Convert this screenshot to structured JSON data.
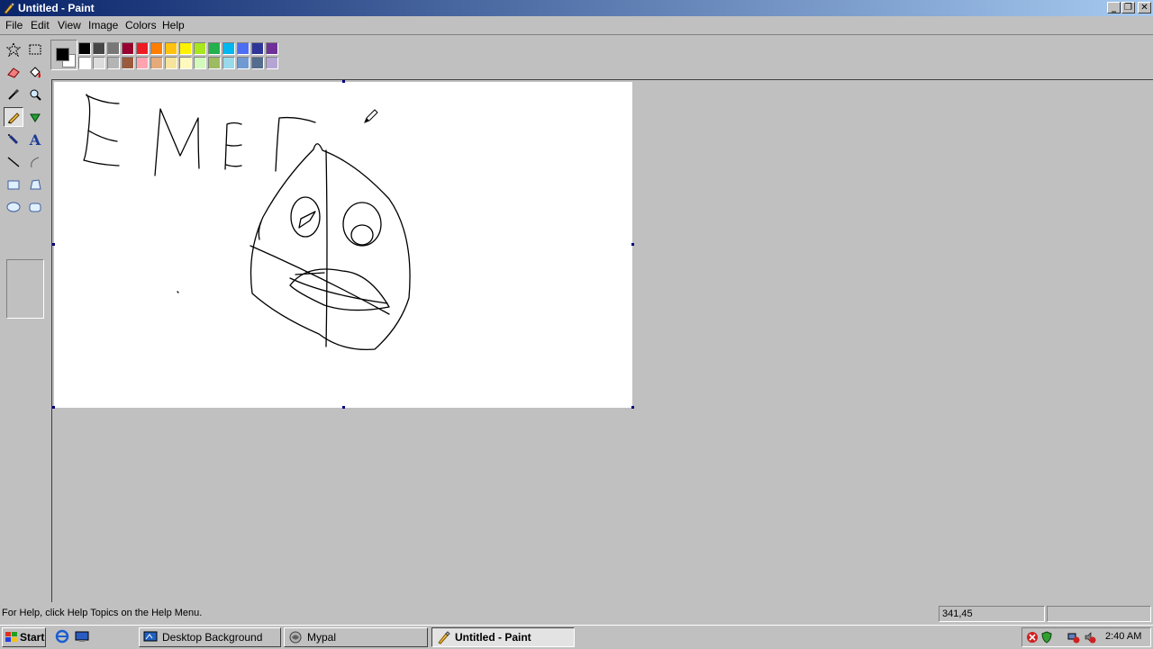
{
  "window": {
    "title": "Untitled - Paint"
  },
  "menu": {
    "items": [
      "File",
      "Edit",
      "View",
      "Image",
      "Colors",
      "Help"
    ]
  },
  "tools": [
    {
      "name": "free-form-select-tool",
      "icon": "star-select-icon"
    },
    {
      "name": "select-tool",
      "icon": "rect-select-icon"
    },
    {
      "name": "eraser-tool",
      "icon": "eraser-icon"
    },
    {
      "name": "fill-tool",
      "icon": "paint-bucket-icon"
    },
    {
      "name": "pick-color-tool",
      "icon": "eyedropper-icon"
    },
    {
      "name": "magnifier-tool",
      "icon": "magnifier-icon"
    },
    {
      "name": "pencil-tool",
      "icon": "pencil-icon",
      "active": true
    },
    {
      "name": "brush-tool",
      "icon": "brush-icon"
    },
    {
      "name": "airbrush-tool",
      "icon": "airbrush-icon"
    },
    {
      "name": "text-tool",
      "icon": "text-a-icon"
    },
    {
      "name": "line-tool",
      "icon": "line-icon"
    },
    {
      "name": "curve-tool",
      "icon": "curve-icon"
    },
    {
      "name": "rectangle-tool",
      "icon": "rectangle-icon"
    },
    {
      "name": "polygon-tool",
      "icon": "polygon-icon"
    },
    {
      "name": "ellipse-tool",
      "icon": "ellipse-icon"
    },
    {
      "name": "rounded-rectangle-tool",
      "icon": "rounded-rect-icon"
    }
  ],
  "palette": {
    "foreground": "#000000",
    "background": "#ffffff",
    "row1": [
      "#000000",
      "#464646",
      "#787878",
      "#990030",
      "#ed1c24",
      "#ff7e00",
      "#ffc20e",
      "#fff200",
      "#a8e61d",
      "#22b14c",
      "#00b7ef",
      "#4d6df3",
      "#2f3699",
      "#6f3198"
    ],
    "row2": [
      "#ffffff",
      "#dcdcdc",
      "#b4b4b4",
      "#9c5a3c",
      "#ffa3b1",
      "#e5aa7a",
      "#f5e49c",
      "#fff9bd",
      "#d3f9bc",
      "#9dbb61",
      "#99d9ea",
      "#709ad1",
      "#546d8e",
      "#b5a5d5"
    ]
  },
  "status": {
    "help": "For Help, click Help Topics on the Help Menu.",
    "coords": "341,45",
    "size": ""
  },
  "taskbar": {
    "start": "Start",
    "tasks": [
      {
        "label": "Desktop Background",
        "icon": "display-properties-icon"
      },
      {
        "label": "Mypal",
        "icon": "mypal-browser-icon"
      },
      {
        "label": "Untitled - Paint",
        "icon": "paint-icon",
        "active": true
      }
    ],
    "clock": "2:40 AM"
  }
}
